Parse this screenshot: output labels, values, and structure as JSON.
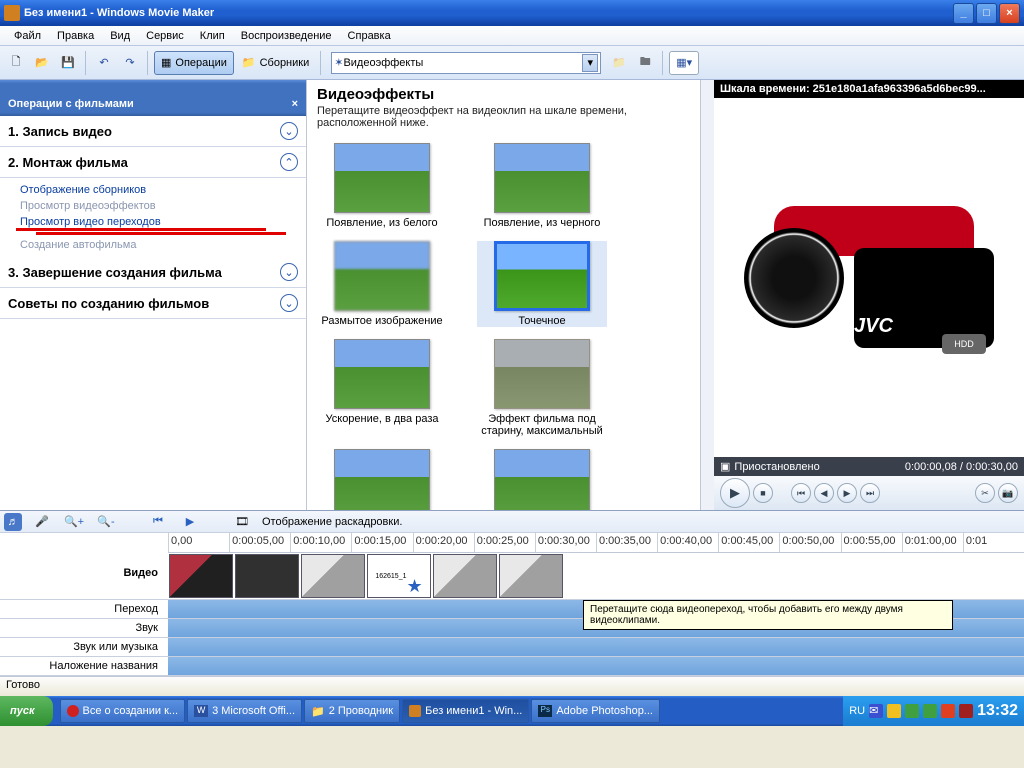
{
  "title": "Без имени1 - Windows Movie Maker",
  "menu": [
    "Файл",
    "Правка",
    "Вид",
    "Сервис",
    "Клип",
    "Воспроизведение",
    "Справка"
  ],
  "toolbar": {
    "ops": "Операции",
    "cols": "Сборники",
    "combo_value": "Видеоэффекты"
  },
  "taskpane": {
    "head": "Операции с фильмами",
    "s1": "1. Запись видео",
    "s2": "2. Монтаж фильма",
    "s2_items": {
      "a": "Отображение сборников",
      "b": "Просмотр видеоэффектов",
      "c": "Просмотр видео переходов",
      "e": "Создание автофильма"
    },
    "s3": "3. Завершение создания фильма",
    "s4": "Советы по созданию фильмов"
  },
  "center": {
    "title": "Видеоэффекты",
    "desc": "Перетащите видеоэффект на видеоклип на шкале времени, расположенной ниже.",
    "items": {
      "a": "Появление, из белого",
      "b": "Появление, из черного",
      "c": "Размытое изображение",
      "d": "Точечное",
      "e": "Ускорение, в два раза",
      "f": "Эффект фильма под старину, максимальный"
    }
  },
  "preview": {
    "title": "Шкала времени: 251e180a1afa963396a5d6bec99...",
    "status": "Приостановлено",
    "time": "0:00:00,08 / 0:00:30,00",
    "jvc": "JVC",
    "hdd": "HDD"
  },
  "timeline": {
    "mode": "Отображение раскадровки.",
    "ruler": [
      "0,00",
      "0:00:05,00",
      "0:00:10,00",
      "0:00:15,00",
      "0:00:20,00",
      "0:00:25,00",
      "0:00:30,00",
      "0:00:35,00",
      "0:00:40,00",
      "0:00:45,00",
      "0:00:50,00",
      "0:00:55,00",
      "0:01:00,00",
      "0:01"
    ],
    "tracks": {
      "video": "Видео",
      "trans": "Переход",
      "audio": "Звук",
      "music": "Звук или музыка",
      "title": "Наложение названия"
    },
    "clip_star": "162615_1",
    "tooltip": "Перетащите сюда видеопереход, чтобы добавить его между двумя видеоклипами."
  },
  "statusbar": "Готово",
  "taskbar": {
    "start": "пуск",
    "items": {
      "a": "Все о создании к...",
      "b": "3 Microsoft Offi...",
      "c": "2 Проводник",
      "d": "Без имени1 - Win...",
      "e": "Adobe Photoshop..."
    },
    "lang": "RU",
    "time": "13:32"
  }
}
